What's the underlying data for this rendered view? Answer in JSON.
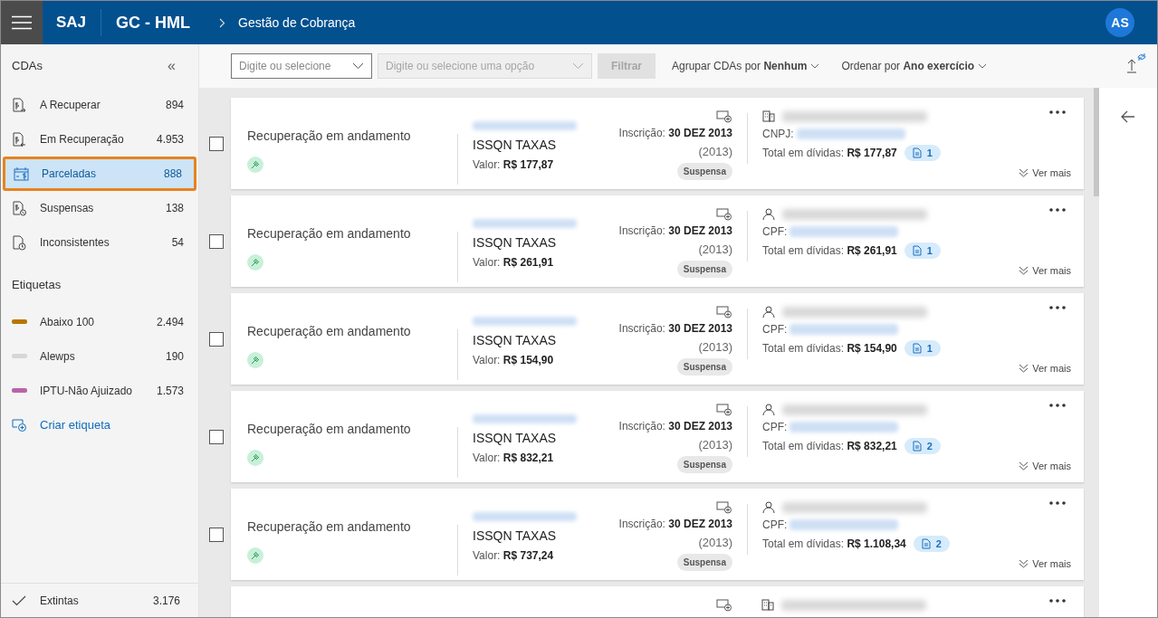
{
  "header": {
    "app": "SAJ",
    "module": "GC - HML",
    "breadcrumb": "Gestão de Cobrança",
    "avatar": "AS"
  },
  "sidebar": {
    "title": "CDAs",
    "collapse": "«",
    "items": [
      {
        "kind": "recover",
        "label": "A Recuperar",
        "count": "894",
        "selected": false
      },
      {
        "kind": "recovering",
        "label": "Em Recuperação",
        "count": "4.953",
        "selected": false
      },
      {
        "kind": "installments",
        "label": "Parceladas",
        "count": "888",
        "selected": true
      },
      {
        "kind": "suspended",
        "label": "Suspensas",
        "count": "138",
        "selected": false
      },
      {
        "kind": "inconsistent",
        "label": "Inconsistentes",
        "count": "54",
        "selected": false
      }
    ],
    "tags_title": "Etiquetas",
    "tags": [
      {
        "label": "Abaixo 100",
        "count": "2.494",
        "color": "#b87600"
      },
      {
        "label": "Alewps",
        "count": "190",
        "color": "#d6d6d6"
      },
      {
        "label": "IPTU-Não Ajuizado",
        "count": "1.573",
        "color": "#b964a8"
      }
    ],
    "create_tag": "Criar etiqueta",
    "footer": {
      "label": "Extintas",
      "count": "3.176"
    }
  },
  "toolbar": {
    "filter_1": {
      "placeholder": "Digite ou selecione",
      "disabled": false
    },
    "filter_2": {
      "placeholder": "Digite ou selecione uma opção",
      "disabled": true
    },
    "filter_button": {
      "label": "Filtrar",
      "disabled": true
    },
    "group": "Agrupar CDAs por **Nenhum**",
    "order": "Ordenar por **Ano exercício**"
  },
  "cards": [
    {
      "checked": false,
      "status": "Recuperação em andamento",
      "tribute": "ISSQN TAXAS",
      "value_label": "Valor:",
      "value": "R$ 177,87",
      "inscription_label": "Inscrição:",
      "inscription_date": "30 DEZ 2013",
      "year": "(2013)",
      "badge": "Suspensa",
      "kind": "company",
      "doc_label": "CNPJ:",
      "total_label": "Total em dívidas:",
      "total": "R$ 177,87",
      "doc_count": "1",
      "more": "Ver mais"
    },
    {
      "checked": false,
      "status": "Recuperação em andamento",
      "tribute": "ISSQN TAXAS",
      "value_label": "Valor:",
      "value": "R$ 261,91",
      "inscription_label": "Inscrição:",
      "inscription_date": "30 DEZ 2013",
      "year": "(2013)",
      "badge": "Suspensa",
      "kind": "person",
      "doc_label": "CPF:",
      "total_label": "Total em dívidas:",
      "total": "R$ 261,91",
      "doc_count": "1",
      "more": "Ver mais"
    },
    {
      "checked": false,
      "status": "Recuperação em andamento",
      "tribute": "ISSQN TAXAS",
      "value_label": "Valor:",
      "value": "R$ 154,90",
      "inscription_label": "Inscrição:",
      "inscription_date": "30 DEZ 2013",
      "year": "(2013)",
      "badge": "Suspensa",
      "kind": "person",
      "doc_label": "CPF:",
      "total_label": "Total em dívidas:",
      "total": "R$ 154,90",
      "doc_count": "1",
      "more": "Ver mais"
    },
    {
      "checked": false,
      "status": "Recuperação em andamento",
      "tribute": "ISSQN TAXAS",
      "value_label": "Valor:",
      "value": "R$ 832,21",
      "inscription_label": "Inscrição:",
      "inscription_date": "30 DEZ 2013",
      "year": "(2013)",
      "badge": "Suspensa",
      "kind": "person",
      "doc_label": "CPF:",
      "total_label": "Total em dívidas:",
      "total": "R$ 832,21",
      "doc_count": "2",
      "more": "Ver mais"
    },
    {
      "checked": false,
      "status": "Recuperação em andamento",
      "tribute": "ISSQN TAXAS",
      "value_label": "Valor:",
      "value": "R$ 737,24",
      "inscription_label": "Inscrição:",
      "inscription_date": "30 DEZ 2013",
      "year": "(2013)",
      "badge": "Suspensa",
      "kind": "person",
      "doc_label": "CPF:",
      "total_label": "Total em dívidas:",
      "total": "R$ 1.108,34",
      "doc_count": "2",
      "more": "Ver mais"
    },
    {
      "kind": "company"
    }
  ]
}
